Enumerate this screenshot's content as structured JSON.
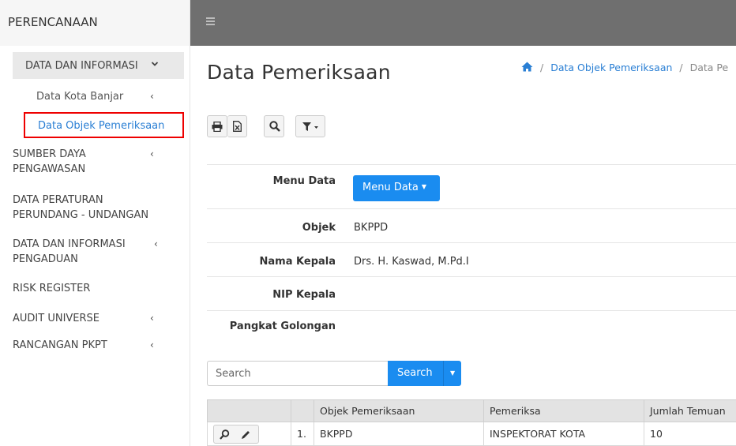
{
  "sidebar": {
    "brand": "PERENCANAAN",
    "items": [
      {
        "label": "DATA DAN INFORMASI",
        "chevron": "˅"
      },
      {
        "label": "Data Kota Banjar",
        "chevron": "‹"
      },
      {
        "label": "Data Objek Pemeriksaan"
      },
      {
        "label": "SUMBER DAYA PENGAWASAN",
        "chevron": "‹"
      },
      {
        "label": "DATA PERATURAN PERUNDANG - UNDANGAN"
      },
      {
        "label": "DATA DAN INFORMASI PENGADUAN",
        "chevron": "‹"
      },
      {
        "label": "RISK REGISTER"
      },
      {
        "label": "AUDIT UNIVERSE",
        "chevron": "‹"
      },
      {
        "label": "RANCANGAN PKPT",
        "chevron": "‹"
      }
    ]
  },
  "topbar": {
    "menu_icon": "hamburger-icon"
  },
  "page": {
    "title": "Data Pemeriksaan",
    "breadcrumb": {
      "home_icon": "home-icon",
      "sep": "/",
      "link": "Data Objek Pemeriksaan",
      "current": "Data Pe"
    }
  },
  "toolbar": {
    "icons": [
      "print-icon",
      "excel-icon",
      "search-icon",
      "filter-icon"
    ]
  },
  "form": {
    "menu_data_label": "Menu Data",
    "menu_data_button": "Menu Data",
    "objek_label": "Objek",
    "objek_value": "BKPPD",
    "nama_kepala_label": "Nama Kepala",
    "nama_kepala_value": "Drs. H. Kaswad, M.Pd.I",
    "nip_label": "NIP Kepala",
    "pangkat_label": "Pangkat Golongan"
  },
  "search": {
    "placeholder": "Search",
    "button": "Search"
  },
  "table": {
    "headers": [
      "",
      "",
      "Objek Pemeriksaan",
      "Pemeriksa",
      "Jumlah Temuan"
    ],
    "rows": [
      {
        "no": "1.",
        "objek": "BKPPD",
        "pemeriksa": "INSPEKTORAT KOTA",
        "jumlah": "10"
      }
    ]
  },
  "colors": {
    "accent": "#1a8cf0",
    "highlight_border": "#e00000",
    "topbar": "#6f6f6f"
  }
}
